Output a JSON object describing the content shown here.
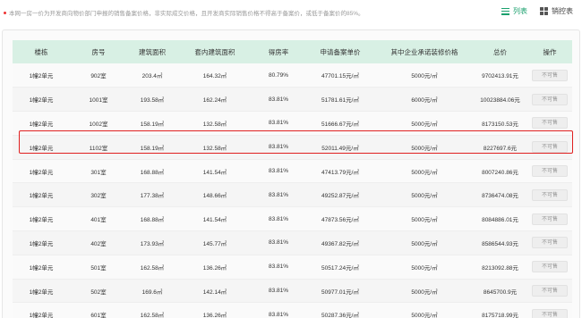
{
  "notice": "本网一房一价为开发商向物价部门申报的销售备案价格，非实际成交价格，且开发商实际销售价格不得高于备案价，或低于备案价的85%。",
  "views": {
    "list_label": "列表",
    "table_label": "销控表"
  },
  "columns": [
    "楼栋",
    "房号",
    "建筑面积",
    "套内建筑面积",
    "得房率",
    "申请备案单价",
    "其中企业承诺装修价格",
    "总价",
    "操作"
  ],
  "rows": [
    [
      "1幢2单元",
      "902室",
      "203.4㎡",
      "164.32㎡",
      "80.79%",
      "47701.15元/㎡",
      "5000元/㎡",
      "9702413.91元",
      "不可售"
    ],
    [
      "1幢2单元",
      "1001室",
      "193.58㎡",
      "162.24㎡",
      "83.81%",
      "51781.61元/㎡",
      "6000元/㎡",
      "10023884.06元",
      "不可售"
    ],
    [
      "1幢2单元",
      "1002室",
      "158.19㎡",
      "132.58㎡",
      "83.81%",
      "51666.67元/㎡",
      "5000元/㎡",
      "8173150.53元",
      "不可售"
    ],
    [
      "1幢2单元",
      "1102室",
      "158.19㎡",
      "132.58㎡",
      "83.81%",
      "52011.49元/㎡",
      "5000元/㎡",
      "8227697.6元",
      "不可售"
    ],
    [
      "1幢2单元",
      "301室",
      "168.88㎡",
      "141.54㎡",
      "83.81%",
      "47413.79元/㎡",
      "5000元/㎡",
      "8007240.86元",
      "不可售"
    ],
    [
      "1幢2单元",
      "302室",
      "177.38㎡",
      "148.66㎡",
      "83.81%",
      "49252.87元/㎡",
      "5000元/㎡",
      "8736474.08元",
      "不可售"
    ],
    [
      "1幢2单元",
      "401室",
      "168.88㎡",
      "141.54㎡",
      "83.81%",
      "47873.56元/㎡",
      "5000元/㎡",
      "8084886.01元",
      "不可售"
    ],
    [
      "1幢2单元",
      "402室",
      "173.93㎡",
      "145.77㎡",
      "83.81%",
      "49367.82元/㎡",
      "5000元/㎡",
      "8586544.93元",
      "不可售"
    ],
    [
      "1幢2单元",
      "501室",
      "162.58㎡",
      "136.26㎡",
      "83.81%",
      "50517.24元/㎡",
      "5000元/㎡",
      "8213092.88元",
      "不可售"
    ],
    [
      "1幢2单元",
      "502室",
      "169.6㎡",
      "142.14㎡",
      "83.81%",
      "50977.01元/㎡",
      "5000元/㎡",
      "8645700.9元",
      "不可售"
    ],
    [
      "1幢2单元",
      "601室",
      "162.58㎡",
      "136.26㎡",
      "83.81%",
      "50287.36元/㎡",
      "5000元/㎡",
      "8175718.99元",
      "不可售"
    ]
  ],
  "highlighted_room": "1102室",
  "colors": {
    "accent": "#1aa06d",
    "header_bg": "#d8f0e4",
    "highlight": "#e02020"
  }
}
